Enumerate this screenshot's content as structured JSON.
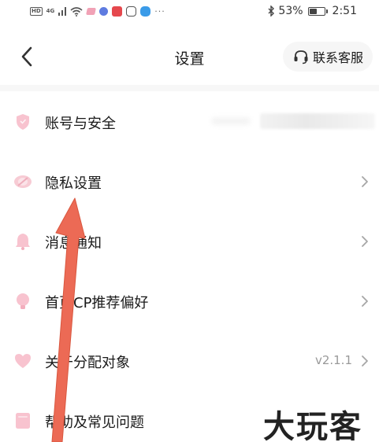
{
  "status_bar": {
    "left_badges": [
      "HD",
      "4G"
    ],
    "battery_percent": "53%",
    "battery_level": 0.53,
    "time": "2:51",
    "more": "···"
  },
  "nav": {
    "title": "设置",
    "customer_service": "联系客服"
  },
  "settings_items": [
    {
      "label": "账号与安全",
      "value": "",
      "has_chevron": false,
      "icon": "shield-icon"
    },
    {
      "label": "隐私设置",
      "value": "",
      "has_chevron": true,
      "icon": "privacy-icon"
    },
    {
      "label": "消息通知",
      "value": "",
      "has_chevron": true,
      "icon": "bell-icon"
    },
    {
      "label": "首页CP推荐偏好",
      "value": "",
      "has_chevron": true,
      "icon": "lightbulb-icon"
    },
    {
      "label": "关于分配对象",
      "value": "v2.1.1",
      "has_chevron": true,
      "icon": "heart-icon"
    },
    {
      "label": "帮助及常见问题",
      "value": "",
      "has_chevron": false,
      "icon": "help-book-icon"
    }
  ],
  "colors": {
    "icon_pink": "#f8c3cf",
    "arrow_red": "#ec6a55",
    "chevron": "#a6a6a6",
    "version_text": "#999999"
  },
  "watermark": "大玩客"
}
